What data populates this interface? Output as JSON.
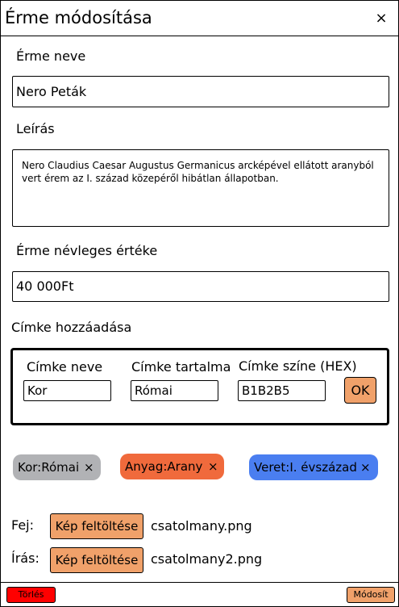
{
  "dialog": {
    "title": "Érme módosítása",
    "close_icon": "×"
  },
  "coin_name": {
    "label": "Érme neve",
    "value": "Nero Peták"
  },
  "description": {
    "label": "Leírás",
    "value": "Nero Claudius Caesar Augustus Germanicus arcképével ellátott aranyból vert érem az I. század közepéről hibátlan állapotban."
  },
  "face_value": {
    "label": "Érme névleges értéke",
    "value": "40 000Ft"
  },
  "tag_add": {
    "section_label": "Címke hozzáadása",
    "name_label": "Címke neve",
    "name_value": "Kor",
    "content_label": "Címke tartalma",
    "content_value": "Római",
    "color_label": "Címke színe (HEX)",
    "color_value": "B1B2B5",
    "ok_label": "OK"
  },
  "tags": [
    {
      "text": "Kor:Római",
      "color": "#b1b2b5",
      "remove_icon": "×"
    },
    {
      "text": "Anyag:Arany",
      "color": "#f06a3c",
      "remove_icon": "×"
    },
    {
      "text": "Veret:I. évszázad",
      "color": "#4a7ef0",
      "remove_icon": "×"
    }
  ],
  "uploads": {
    "front_label": "Fej:",
    "back_label": "Írás:",
    "button_label": "Kép feltöltése",
    "front_file": "csatolmany.png",
    "back_file": "csatolmany2.png"
  },
  "footer": {
    "delete_label": "Törlés",
    "save_label": "Módosít"
  },
  "colors": {
    "accent": "#f0a16a",
    "delete": "#ff0000"
  }
}
